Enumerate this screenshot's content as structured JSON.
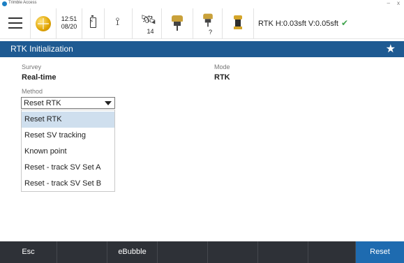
{
  "window": {
    "title": "Trimble Access",
    "minimize_glyph": "–",
    "close_glyph": "x"
  },
  "statusbar": {
    "time": "12:51",
    "date": "08/20",
    "satellites": "14",
    "unknown_indicator": "?",
    "rtk_precision": "RTK H:0.03sft V:0.05sft",
    "rtk_status_icon": "check-icon",
    "rtk_status_color": "#3fa34d"
  },
  "header": {
    "title": "RTK Initialization",
    "favorite_icon": "star-icon"
  },
  "form": {
    "survey_label": "Survey",
    "survey_value": "Real-time",
    "mode_label": "Mode",
    "mode_value": "RTK",
    "method_label": "Method",
    "method_selected": "Reset RTK"
  },
  "dropdown": {
    "options": [
      "Reset RTK",
      "Reset SV tracking",
      "Known point",
      "Reset - track SV Set A",
      "Reset - track SV Set B"
    ],
    "selected_index": 0
  },
  "bottombar": {
    "esc_label": "Esc",
    "ebubble_label": "eBubble",
    "reset_label": "Reset"
  },
  "colors": {
    "header_bg": "#1e5a92",
    "bottom_bg": "#2e3137",
    "primary_button": "#1e6bb0",
    "selected_option": "#cfdfee"
  }
}
